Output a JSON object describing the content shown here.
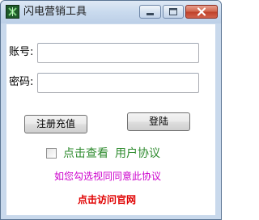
{
  "window": {
    "title": "闪电营销工具",
    "icon": "app-icon",
    "controls": {
      "minimize_icon": "minimize-icon",
      "maximize_icon": "maximize-icon",
      "close_icon": "close-icon"
    }
  },
  "form": {
    "account_label": "账号:",
    "account_value": "",
    "password_label": "密码:",
    "password_value": ""
  },
  "buttons": {
    "register_recharge": "注册充值",
    "login": "登陆"
  },
  "agreement": {
    "checked": false,
    "view_text": "点击查看",
    "agreement_link": "用户协议",
    "notice": "如您勾选视同同意此协议"
  },
  "footer": {
    "visit_site": "点击访问官网"
  },
  "colors": {
    "green": "#2e8b2e",
    "magenta": "#cc00cc",
    "red": "#e00000",
    "titlebar": "#c9daee"
  }
}
